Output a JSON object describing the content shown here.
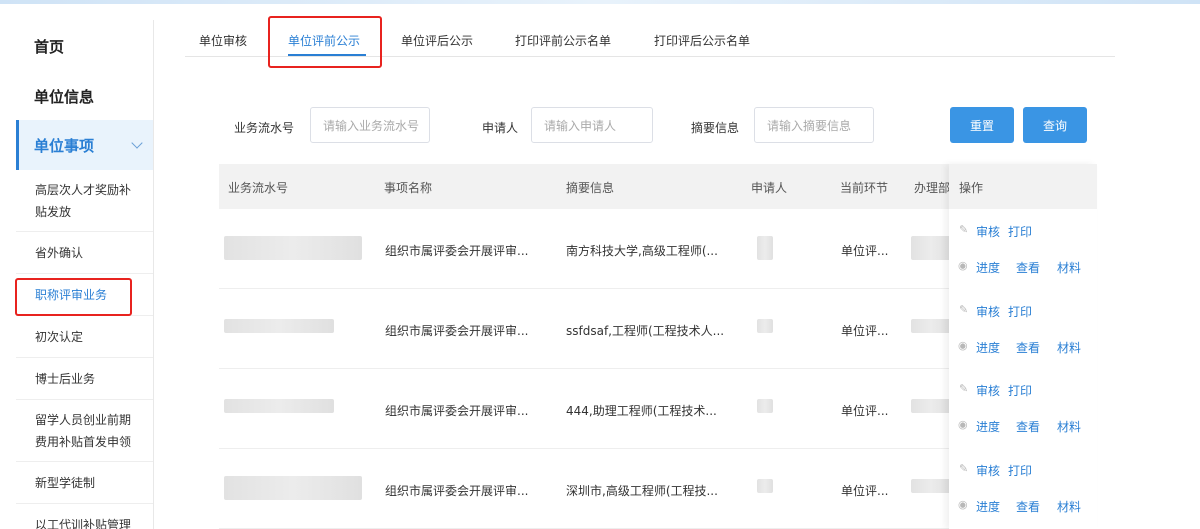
{
  "sidebar": {
    "home": "首页",
    "unit_info": "单位信息",
    "unit_matters": "单位事项",
    "sub_items": [
      "高层次人才奖励补贴发放",
      "省外确认",
      "职称评审业务",
      "初次认定",
      "博士后业务",
      "留学人员创业前期费用补贴首发申领",
      "新型学徒制",
      "以工代训补贴管理"
    ]
  },
  "tabs": [
    "单位审核",
    "单位评前公示",
    "单位评后公示",
    "打印评前公示名单",
    "打印评后公示名单"
  ],
  "filters": {
    "serial_label": "业务流水号",
    "serial_placeholder": "请输入业务流水号",
    "applicant_label": "申请人",
    "applicant_placeholder": "请输入申请人",
    "summary_label": "摘要信息",
    "summary_placeholder": "请输入摘要信息",
    "reset": "重置",
    "query": "查询"
  },
  "table": {
    "headers": [
      "业务流水号",
      "事项名称",
      "摘要信息",
      "申请人",
      "当前环节",
      "办理部门",
      "操作"
    ],
    "rows": [
      {
        "item": "组织市属评委会开展评审...",
        "summary": "南方科技大学,高级工程师(...",
        "stage": "单位评..."
      },
      {
        "item": "组织市属评委会开展评审...",
        "summary": "ssfdsaf,工程师(工程技术人...",
        "stage": "单位评..."
      },
      {
        "item": "组织市属评委会开展评审...",
        "summary": "444,助理工程师(工程技术...",
        "stage": "单位评..."
      },
      {
        "item": "组织市属评委会开展评审...",
        "summary": "深圳市,高级工程师(工程技...",
        "stage": "单位评..."
      }
    ],
    "ops": {
      "audit": "审核",
      "print": "打印",
      "progress": "进度",
      "view": "查看",
      "material": "材料"
    }
  },
  "colors": {
    "accent": "#2a7fd4",
    "highlight": "#e8231f",
    "button": "#3a95e4"
  }
}
